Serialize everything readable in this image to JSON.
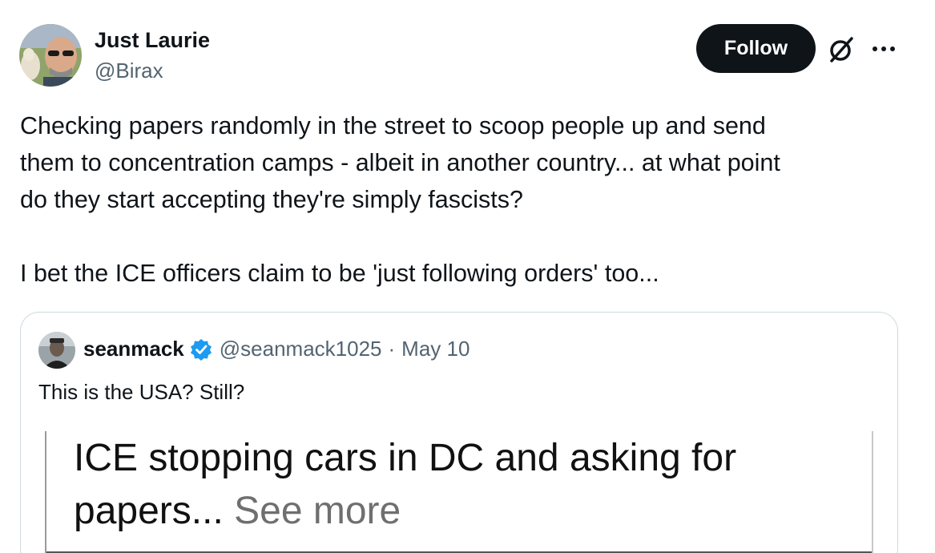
{
  "author": {
    "display_name": "Just Laurie",
    "handle": "@Birax"
  },
  "actions": {
    "follow_label": "Follow",
    "grok_icon": "grok-icon",
    "more_icon": "more-options-icon"
  },
  "tweet": {
    "paragraph1_lines": [
      "Checking papers randomly in the street to scoop people up and send",
      "them to concentration camps - albeit in another country... at what point",
      "do they start accepting they're simply fascists?"
    ],
    "paragraph2": "I bet the ICE officers claim to be 'just following orders' too..."
  },
  "quote": {
    "display_name": "seanmack",
    "verified": true,
    "handle": "@seanmack1025",
    "separator": "·",
    "date": "May 10",
    "text": "This is the USA? Still?",
    "media": {
      "line1": "ICE stopping cars in DC and asking for",
      "line2": "papers...",
      "see_more": "See more"
    }
  },
  "colors": {
    "text_primary": "#0f1419",
    "text_secondary": "#536471",
    "follow_bg": "#0f1419",
    "verified_blue": "#1d9bf0",
    "border": "#cfd9de"
  }
}
